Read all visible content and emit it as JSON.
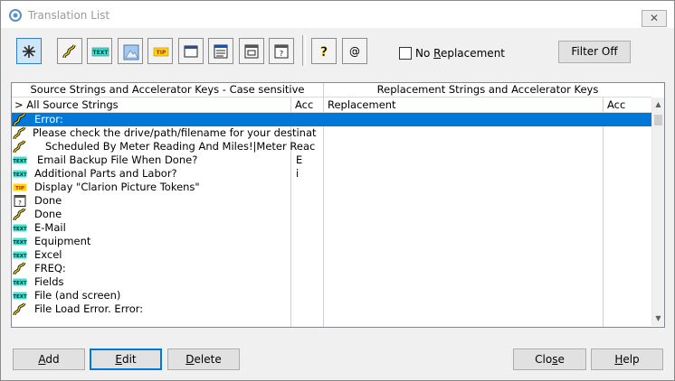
{
  "window": {
    "title": "Translation List",
    "close_glyph": "✕"
  },
  "toolbar": {
    "buttons": [
      {
        "name": "all-strings-button",
        "icon": "asterisk-icon"
      },
      {
        "name": "accelerator-strings-button",
        "icon": "squiggle-icon"
      },
      {
        "name": "text-strings-button",
        "icon": "text-badge-icon",
        "badge": "TEXT"
      },
      {
        "name": "picture-strings-button",
        "icon": "picture-icon"
      },
      {
        "name": "tip-strings-button",
        "icon": "tip-badge-icon",
        "badge": "TIP"
      },
      {
        "name": "window-strings-button",
        "icon": "window-icon"
      },
      {
        "name": "report-strings-button",
        "icon": "report-icon"
      },
      {
        "name": "frame-strings-button",
        "icon": "frame-icon"
      },
      {
        "name": "prompt-strings-button",
        "icon": "prompt-icon"
      },
      {
        "name": "help-button-toolbar",
        "icon": "question-icon",
        "glyph": "?"
      },
      {
        "name": "at-button",
        "icon": "at-icon",
        "glyph": "@"
      }
    ]
  },
  "no_replacement": {
    "label_prefix": "No ",
    "label_u": "R",
    "label_rest": "eplacement",
    "checked": false
  },
  "filter_button": {
    "label": "Filter Off"
  },
  "list": {
    "group_headers": {
      "source": "Source Strings and Accelerator Keys - Case sensitive",
      "replacement": "Replacement Strings and Accelerator Keys"
    },
    "columns": {
      "source": "> All Source Strings",
      "acc1": "Acc",
      "replacement": "Replacement",
      "acc2": "Acc"
    },
    "rows": [
      {
        "icon": "squiggle-icon",
        "text": "Error:",
        "acc": "",
        "selected": true,
        "indent": 0
      },
      {
        "icon": "squiggle-icon",
        "text": "Please check the drive/path/filename for your destinat",
        "acc": "",
        "selected": false,
        "indent": -2
      },
      {
        "icon": "squiggle-icon",
        "text": "Scheduled By Meter Reading And Miles!|Meter Reac",
        "acc": "",
        "selected": false,
        "indent": 12
      },
      {
        "icon": "text-badge-icon",
        "text": "Email Backup File When Done?",
        "acc": "E",
        "selected": false,
        "indent": 3
      },
      {
        "icon": "text-badge-icon",
        "text": "Additional Parts and Labor?",
        "acc": "i",
        "selected": false,
        "indent": 0
      },
      {
        "icon": "tip-badge-icon",
        "text": "Display \"Clarion Picture Tokens\"",
        "acc": "",
        "selected": false,
        "indent": 0
      },
      {
        "icon": "prompt-icon",
        "text": "Done",
        "acc": "",
        "selected": false,
        "indent": 0
      },
      {
        "icon": "squiggle-icon",
        "text": "Done",
        "acc": "",
        "selected": false,
        "indent": 0
      },
      {
        "icon": "text-badge-icon",
        "text": "E-Mail",
        "acc": "",
        "selected": false,
        "indent": 0
      },
      {
        "icon": "text-badge-icon",
        "text": "Equipment",
        "acc": "",
        "selected": false,
        "indent": 0
      },
      {
        "icon": "text-badge-icon",
        "text": "Excel",
        "acc": "",
        "selected": false,
        "indent": 0
      },
      {
        "icon": "squiggle-icon",
        "text": "FREQ:",
        "acc": "",
        "selected": false,
        "indent": 0
      },
      {
        "icon": "text-badge-icon",
        "text": "Fields",
        "acc": "",
        "selected": false,
        "indent": 0
      },
      {
        "icon": "text-badge-icon",
        "text": "File (and screen)",
        "acc": "",
        "selected": false,
        "indent": 0
      },
      {
        "icon": "squiggle-icon",
        "text": "File Load Error.  Error:",
        "acc": "",
        "selected": false,
        "indent": 0
      }
    ]
  },
  "buttons": {
    "add": {
      "u": "A",
      "rest": "dd"
    },
    "edit": {
      "u": "E",
      "rest": "dit"
    },
    "delete": {
      "u": "D",
      "rest": "elete"
    },
    "close": {
      "pre": "Clo",
      "u": "s",
      "rest": "e"
    },
    "help": {
      "u": "H",
      "rest": "elp"
    }
  },
  "colors": {
    "selection": "#0078d7",
    "text_badge": "#40e0d0",
    "tip_badge": "#ffd700",
    "accent": "#0078d7"
  }
}
